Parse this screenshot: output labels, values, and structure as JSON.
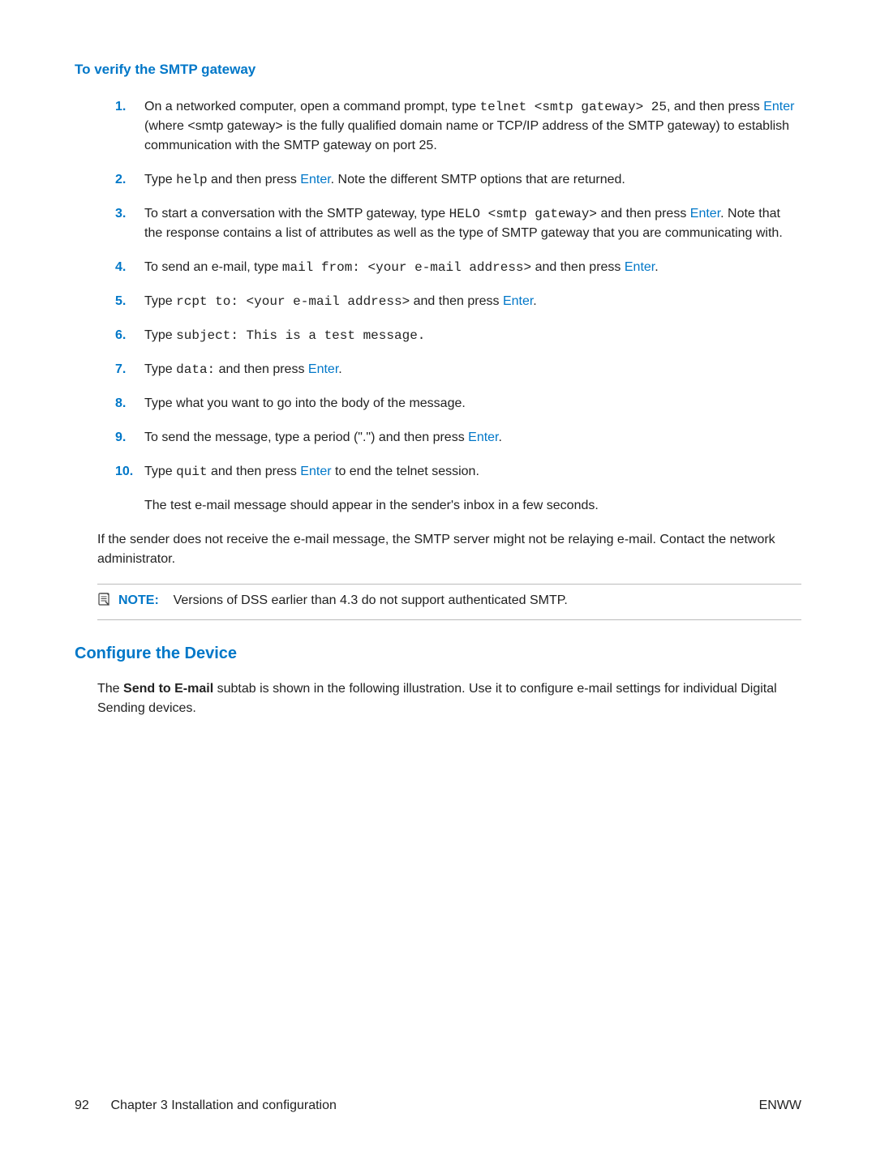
{
  "headings": {
    "verify": "To verify the SMTP gateway",
    "configure": "Configure the Device"
  },
  "steps": [
    {
      "num": "1.",
      "parts": [
        {
          "t": "On a networked computer, open a command prompt, type "
        },
        {
          "t": "telnet <smtp gateway> 25",
          "mono": true
        },
        {
          "t": ", and then press "
        },
        {
          "t": "Enter",
          "enter": true
        },
        {
          "t": " (where <smtp gateway> is the fully qualified domain name or TCP/IP address of the SMTP gateway) to establish communication with the SMTP gateway on port 25."
        }
      ]
    },
    {
      "num": "2.",
      "parts": [
        {
          "t": "Type "
        },
        {
          "t": "help",
          "mono": true
        },
        {
          "t": " and then press "
        },
        {
          "t": "Enter",
          "enter": true
        },
        {
          "t": ". Note the different SMTP options that are returned."
        }
      ]
    },
    {
      "num": "3.",
      "parts": [
        {
          "t": "To start a conversation with the SMTP gateway, type "
        },
        {
          "t": "HELO <smtp gateway>",
          "mono": true
        },
        {
          "t": " and then press "
        },
        {
          "t": "Enter",
          "enter": true
        },
        {
          "t": ". Note that the response contains a list of attributes as well as the type of SMTP gateway that you are communicating with."
        }
      ]
    },
    {
      "num": "4.",
      "parts": [
        {
          "t": "To send an e-mail, type "
        },
        {
          "t": "mail from: <your e-mail address>",
          "mono": true
        },
        {
          "t": " and then press "
        },
        {
          "t": "Enter",
          "enter": true
        },
        {
          "t": "."
        }
      ]
    },
    {
      "num": "5.",
      "parts": [
        {
          "t": "Type "
        },
        {
          "t": "rcpt to: <your e-mail address>",
          "mono": true
        },
        {
          "t": " and then press "
        },
        {
          "t": "Enter",
          "enter": true
        },
        {
          "t": "."
        }
      ]
    },
    {
      "num": "6.",
      "parts": [
        {
          "t": "Type "
        },
        {
          "t": "subject: This is a test message.",
          "mono": true
        }
      ]
    },
    {
      "num": "7.",
      "parts": [
        {
          "t": "Type "
        },
        {
          "t": "data:",
          "mono": true
        },
        {
          "t": " and then press "
        },
        {
          "t": "Enter",
          "enter": true
        },
        {
          "t": "."
        }
      ]
    },
    {
      "num": "8.",
      "parts": [
        {
          "t": "Type what you want to go into the body of the message."
        }
      ]
    },
    {
      "num": "9.",
      "parts": [
        {
          "t": "To send the message, type a period (\".\") and then press "
        },
        {
          "t": "Enter",
          "enter": true
        },
        {
          "t": "."
        }
      ]
    },
    {
      "num": "10.",
      "parts": [
        {
          "t": "Type "
        },
        {
          "t": "quit",
          "mono": true
        },
        {
          "t": " and then press "
        },
        {
          "t": "Enter",
          "enter": true
        },
        {
          "t": " to end the telnet session."
        }
      ]
    }
  ],
  "afterList": "The test e-mail message should appear in the sender's inbox in a few seconds.",
  "failPara": "If the sender does not receive the e-mail message, the SMTP server might not be relaying e-mail. Contact the network administrator.",
  "note": {
    "label": "NOTE:",
    "text": "Versions of DSS earlier than 4.3 do not support authenticated SMTP."
  },
  "configure": {
    "parts": [
      {
        "t": "The "
      },
      {
        "t": "Send to E-mail",
        "bold": true
      },
      {
        "t": " subtab is shown in the following illustration. Use it to configure e-mail settings for individual Digital Sending devices."
      }
    ]
  },
  "footer": {
    "left_page": "92",
    "left_text": "Chapter 3   Installation and configuration",
    "right": "ENWW"
  }
}
